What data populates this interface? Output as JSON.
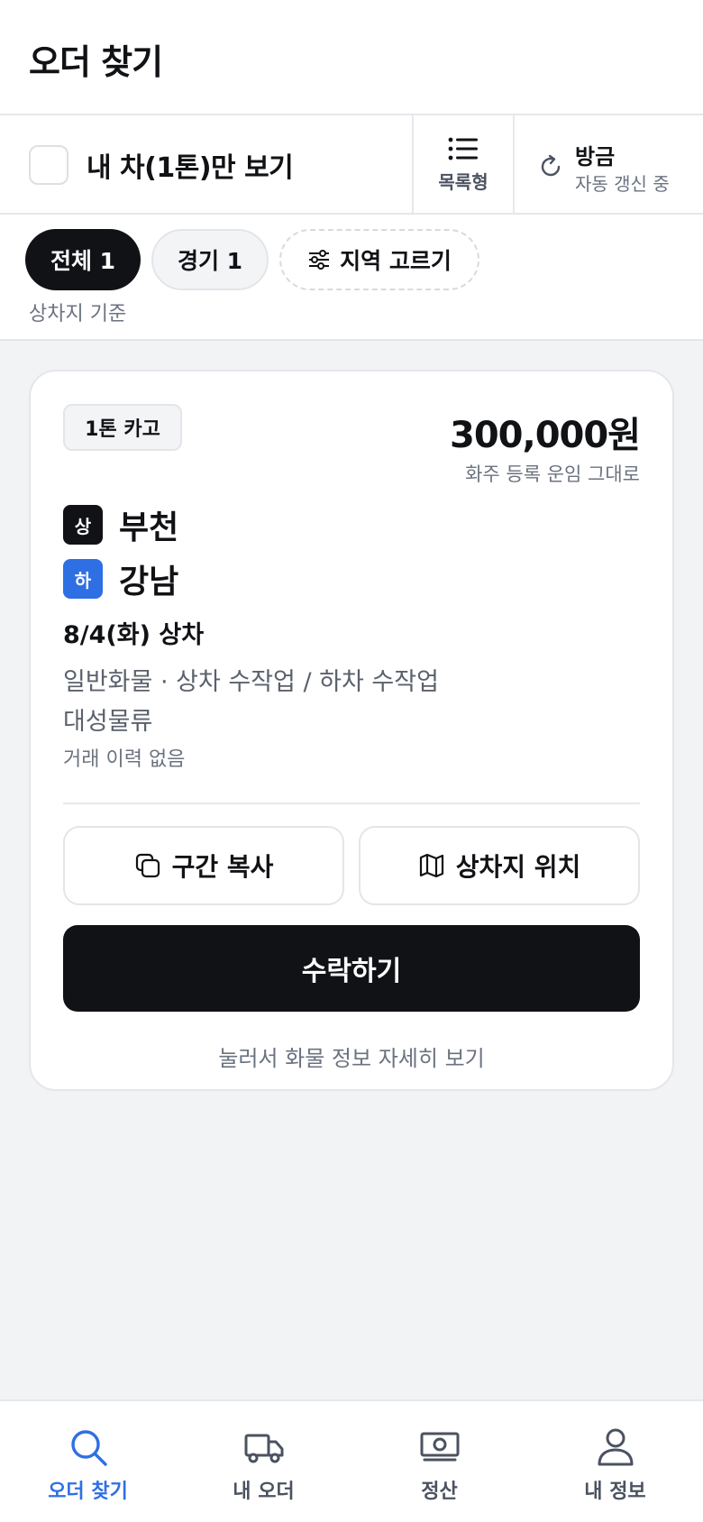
{
  "header": {
    "title": "오더 찾기",
    "my_car_only_label": "내 차(1톤)만 보기",
    "my_car_only_checked": false,
    "view_toggle_label": "목록형",
    "refresh_title": "방금",
    "refresh_subtitle": "자동 갱신 중"
  },
  "filters": {
    "chips": [
      {
        "label": "전체 1",
        "selected": true
      },
      {
        "label": "경기 1",
        "selected": false
      },
      {
        "label": "지역 고르기",
        "selected": false
      }
    ],
    "basis_note": "상차지 기준"
  },
  "order_card": {
    "vehicle_badge": "1톤 카고",
    "price": "300,000원",
    "price_note": "화주 등록 운임 그대로",
    "load_badge": "상",
    "load_location": "부천",
    "unload_badge": "하",
    "unload_location": "강남",
    "load_date": "8/4(화) 상차",
    "cargo_info": "일반화물 · 상차 수작업 / 하차 수작업",
    "company": "대성물류",
    "history": "거래 이력 없음",
    "copy_route_label": "구간 복사",
    "load_location_map_label": "상차지 위치",
    "accept_label": "수락하기",
    "detail_hint": "눌러서 화물 정보 자세히 보기"
  },
  "bottom_nav": {
    "items": [
      {
        "label": "오더 찾기",
        "icon": "search-icon",
        "active": true
      },
      {
        "label": "내 오더",
        "icon": "truck-icon",
        "active": false
      },
      {
        "label": "정산",
        "icon": "money-icon",
        "active": false
      },
      {
        "label": "내 정보",
        "icon": "person-icon",
        "active": false
      }
    ]
  },
  "colors": {
    "primary_dark": "#111215",
    "accent_blue": "#2f6fe4",
    "background": "#f2f3f5"
  }
}
